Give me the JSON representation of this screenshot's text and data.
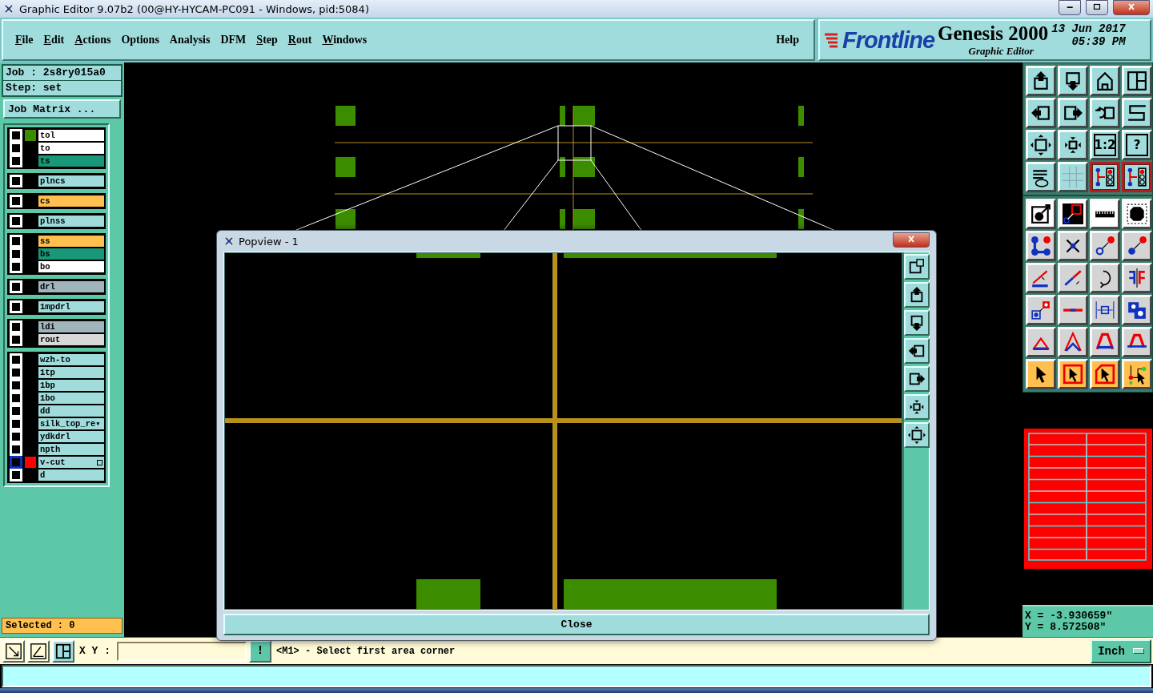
{
  "window": {
    "title": "Graphic Editor 9.07b2 (00@HY-HYCAM-PC091 - Windows, pid:5084)"
  },
  "menu": [
    {
      "label": "File",
      "mnemonic": true
    },
    {
      "label": "Edit",
      "mnemonic": true
    },
    {
      "label": "Actions",
      "mnemonic": true
    },
    {
      "label": "Options",
      "mnemonic": false
    },
    {
      "label": "Analysis",
      "mnemonic": false
    },
    {
      "label": "DFM",
      "mnemonic": false
    },
    {
      "label": "Step",
      "mnemonic": true
    },
    {
      "label": "Rout",
      "mnemonic": true
    },
    {
      "label": "Windows",
      "mnemonic": true
    }
  ],
  "help": {
    "label": "Help"
  },
  "brand": {
    "logo": "Frontline",
    "product": "Genesis 2000",
    "subtitle": "Graphic Editor",
    "date": "13 Jun 2017",
    "time": "05:39 PM"
  },
  "job": {
    "job": "Job : 2s8ry015a0",
    "step": "Step: set",
    "matrix_button": "Job Matrix ..."
  },
  "layer_groups": [
    {
      "layers": [
        {
          "name": "tol",
          "color": "#ffffff",
          "swatch": {
            "color": "#3c8c00"
          },
          "checked": false,
          "selected": false
        },
        {
          "name": "to",
          "color": "#ffffff",
          "checked": false,
          "selected": false
        },
        {
          "name": "ts",
          "color": "#189878",
          "checked": false,
          "selected": false
        }
      ]
    },
    {
      "layers": [
        {
          "name": "plncs",
          "color": "#a0dcdc",
          "checked": false,
          "selected": false
        }
      ]
    },
    {
      "layers": [
        {
          "name": "cs",
          "color": "#ffc050",
          "checked": false,
          "selected": false
        }
      ]
    },
    {
      "layers": [
        {
          "name": "plnss",
          "color": "#a0dcdc",
          "checked": false,
          "selected": false
        }
      ]
    },
    {
      "layers": [
        {
          "name": "ss",
          "color": "#ffc050",
          "checked": false,
          "selected": false
        },
        {
          "name": "bs",
          "color": "#189878",
          "checked": false,
          "selected": false
        },
        {
          "name": "bo",
          "color": "#ffffff",
          "checked": false,
          "selected": false
        }
      ]
    },
    {
      "layers": [
        {
          "name": "drl",
          "color": "#a0b4bc",
          "checked": false,
          "selected": false
        }
      ]
    },
    {
      "layers": [
        {
          "name": "1mpdrl",
          "color": "#a0dcdc",
          "checked": false,
          "selected": false
        }
      ]
    },
    {
      "layers": [
        {
          "name": "ldi",
          "color": "#a0b4bc",
          "checked": false,
          "selected": false
        },
        {
          "name": "rout",
          "color": "#d8d8d8",
          "checked": false,
          "selected": false
        }
      ]
    },
    {
      "layers": [
        {
          "name": "wzh-to",
          "color": "#a0dcdc",
          "checked": false,
          "selected": false
        },
        {
          "name": "1tp",
          "color": "#a0dcdc",
          "checked": false,
          "selected": false
        },
        {
          "name": "1bp",
          "color": "#a0dcdc",
          "checked": false,
          "selected": false
        },
        {
          "name": "1bo",
          "color": "#a0dcdc",
          "checked": false,
          "selected": false
        },
        {
          "name": "dd",
          "color": "#a0dcdc",
          "checked": false,
          "selected": false
        },
        {
          "name": "silk_top_re▾",
          "color": "#a0dcdc",
          "checked": false,
          "selected": false
        },
        {
          "name": "ydkdrl",
          "color": "#a0dcdc",
          "checked": false,
          "selected": false
        },
        {
          "name": "npth",
          "color": "#a0dcdc",
          "checked": false,
          "selected": false
        },
        {
          "name": "v-cut",
          "color": "#a0dcdc",
          "swatch": {
            "color": "#ff0000"
          },
          "checked": false,
          "selected": true
        },
        {
          "name": "d",
          "color": "#a0dcdc",
          "checked": false,
          "selected": false
        }
      ]
    }
  ],
  "selected_count": "Selected : 0",
  "toolbox": {
    "ratio_label": "1:2",
    "help_label": "?"
  },
  "coordinates": {
    "x": "X = -3.930659\"",
    "y": "Y = 8.572508\""
  },
  "bottom_bar": {
    "xy_label": "X Y :",
    "prompt_button": "!",
    "message": "<M1> - Select first area corner",
    "units": "Inch"
  },
  "popview": {
    "title": "Popview - 1",
    "close_button": "Close"
  }
}
